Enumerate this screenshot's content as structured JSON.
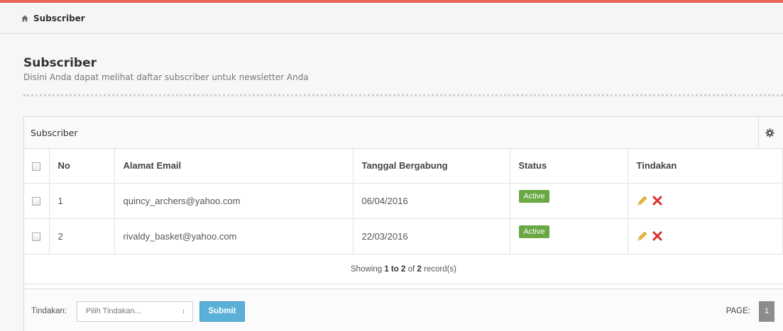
{
  "breadcrumb": {
    "label": "Subscriber",
    "icon": "home-icon"
  },
  "header": {
    "title": "Subscriber",
    "subtitle": "Disini Anda dapat melihat daftar subscriber untuk newsletter Anda"
  },
  "panel": {
    "title": "Subscriber",
    "settings_icon": "gear-icon"
  },
  "table": {
    "columns": [
      "No",
      "Alamat Email",
      "Tanggal Bergabung",
      "Status",
      "Tindakan"
    ],
    "rows": [
      {
        "no": "1",
        "email": "quincy_archers@yahoo.com",
        "date": "06/04/2016",
        "status": "Active"
      },
      {
        "no": "2",
        "email": "rivaldy_basket@yahoo.com",
        "date": "22/03/2016",
        "status": "Active"
      }
    ]
  },
  "records": {
    "prefix": "Showing",
    "range": "1 to 2",
    "of_word": "of",
    "total": "2",
    "suffix": "record(s)"
  },
  "footer": {
    "action_label": "Tindakan:",
    "select_placeholder": "Pilih Tindakan...",
    "submit_label": "Submit",
    "page_label": "PAGE:",
    "current_page": "1"
  },
  "colors": {
    "accent_bar": "#e8675a",
    "status_active": "#6aa844",
    "submit": "#5bb0d8",
    "edit_icon": "#e0b020",
    "delete_icon": "#d9302b"
  }
}
